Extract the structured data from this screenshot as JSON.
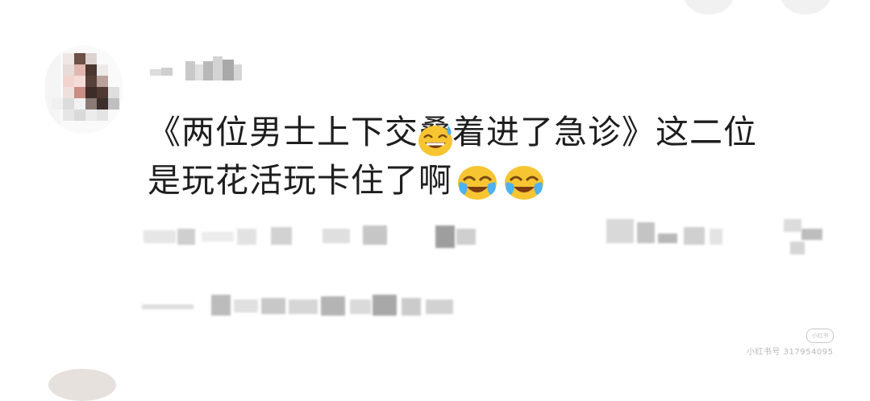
{
  "comment": {
    "line1": "《两位男士上下交叠着进了急诊》这二位",
    "line2": "是玩花活玩卡住了啊"
  },
  "icons": {
    "inline_emoji": "crying-laughing-emoji",
    "overlay_emoji": "grin-sweat-emoji"
  },
  "watermark": {
    "text": "小红书号 317954095",
    "logo": "小红书"
  },
  "colors": {
    "text": "#1e1e1e",
    "emoji_yellow": "#f7c531",
    "tear_blue": "#4fb1f0"
  }
}
